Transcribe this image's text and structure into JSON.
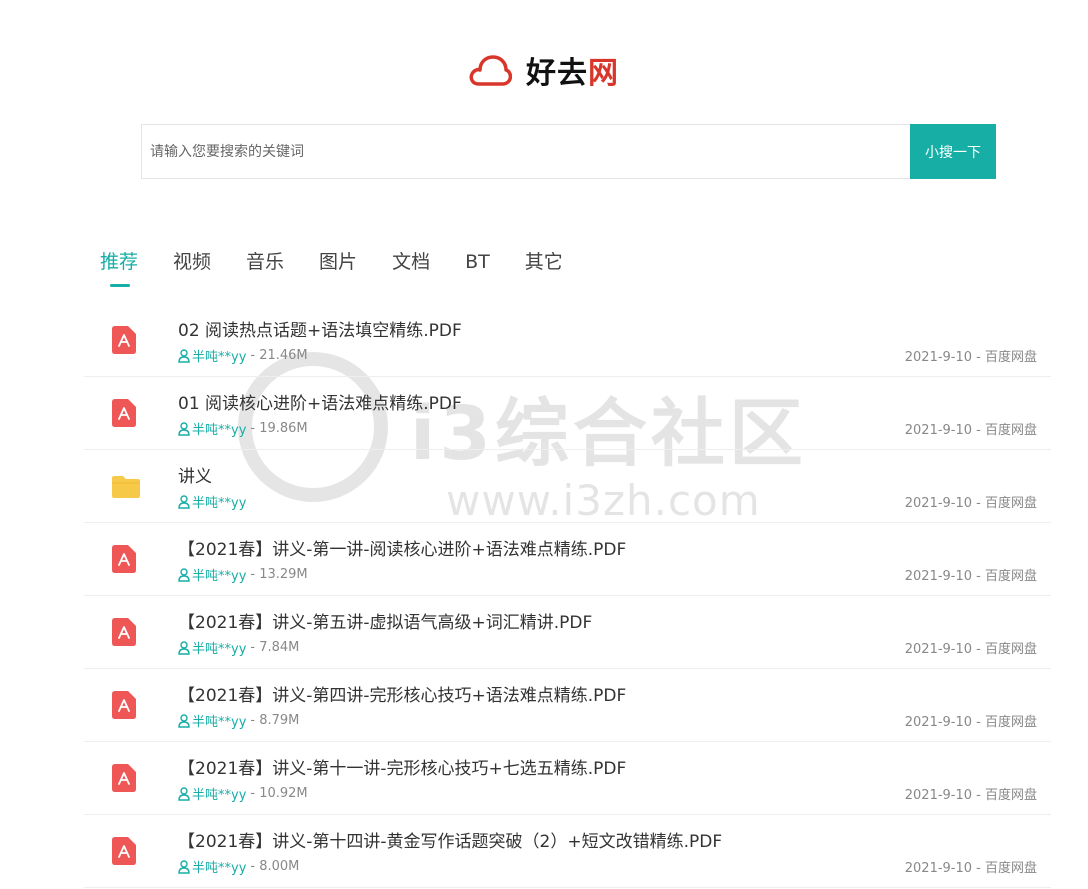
{
  "logo": {
    "text_main": "好去",
    "text_accent": "网"
  },
  "search": {
    "placeholder": "请输入您要搜索的关键词",
    "button_label": "小搜一下"
  },
  "watermark": {
    "big_text": "i3综合社区",
    "small_text": "www.i3zh.com"
  },
  "tabs": [
    {
      "label": "推荐",
      "active": true
    },
    {
      "label": "视频"
    },
    {
      "label": "音乐"
    },
    {
      "label": "图片"
    },
    {
      "label": "文档"
    },
    {
      "label": "BT"
    },
    {
      "label": "其它"
    }
  ],
  "items": [
    {
      "type": "pdf",
      "title": "02 阅读热点话题+语法填空精练.PDF",
      "user": "半吨**yy",
      "size": " - 21.46M",
      "date_source": "2021-9-10 - 百度网盘"
    },
    {
      "type": "pdf",
      "title": "01 阅读核心进阶+语法难点精练.PDF",
      "user": "半吨**yy",
      "size": " - 19.86M",
      "date_source": "2021-9-10 - 百度网盘"
    },
    {
      "type": "folder",
      "title": "讲义",
      "user": "半吨**yy",
      "size": "",
      "date_source": "2021-9-10 - 百度网盘"
    },
    {
      "type": "pdf",
      "title": "【2021春】讲义-第一讲-阅读核心进阶+语法难点精练.PDF",
      "user": "半吨**yy",
      "size": " - 13.29M",
      "date_source": "2021-9-10 - 百度网盘"
    },
    {
      "type": "pdf",
      "title": "【2021春】讲义-第五讲-虚拟语气高级+词汇精讲.PDF",
      "user": "半吨**yy",
      "size": " - 7.84M",
      "date_source": "2021-9-10 - 百度网盘"
    },
    {
      "type": "pdf",
      "title": "【2021春】讲义-第四讲-完形核心技巧+语法难点精练.PDF",
      "user": "半吨**yy",
      "size": " - 8.79M",
      "date_source": "2021-9-10 - 百度网盘"
    },
    {
      "type": "pdf",
      "title": "【2021春】讲义-第十一讲-完形核心技巧+七选五精练.PDF",
      "user": "半吨**yy",
      "size": " - 10.92M",
      "date_source": "2021-9-10 - 百度网盘"
    },
    {
      "type": "pdf",
      "title": "【2021春】讲义-第十四讲-黄金写作话题突破（2）+短文改错精练.PDF",
      "user": "半吨**yy",
      "size": " - 8.00M",
      "date_source": "2021-9-10 - 百度网盘"
    }
  ],
  "colors": {
    "accent": "#17aea6",
    "brand_red": "#d9362b",
    "pdf_red": "#ef5656",
    "folder_yellow": "#f7c948"
  }
}
